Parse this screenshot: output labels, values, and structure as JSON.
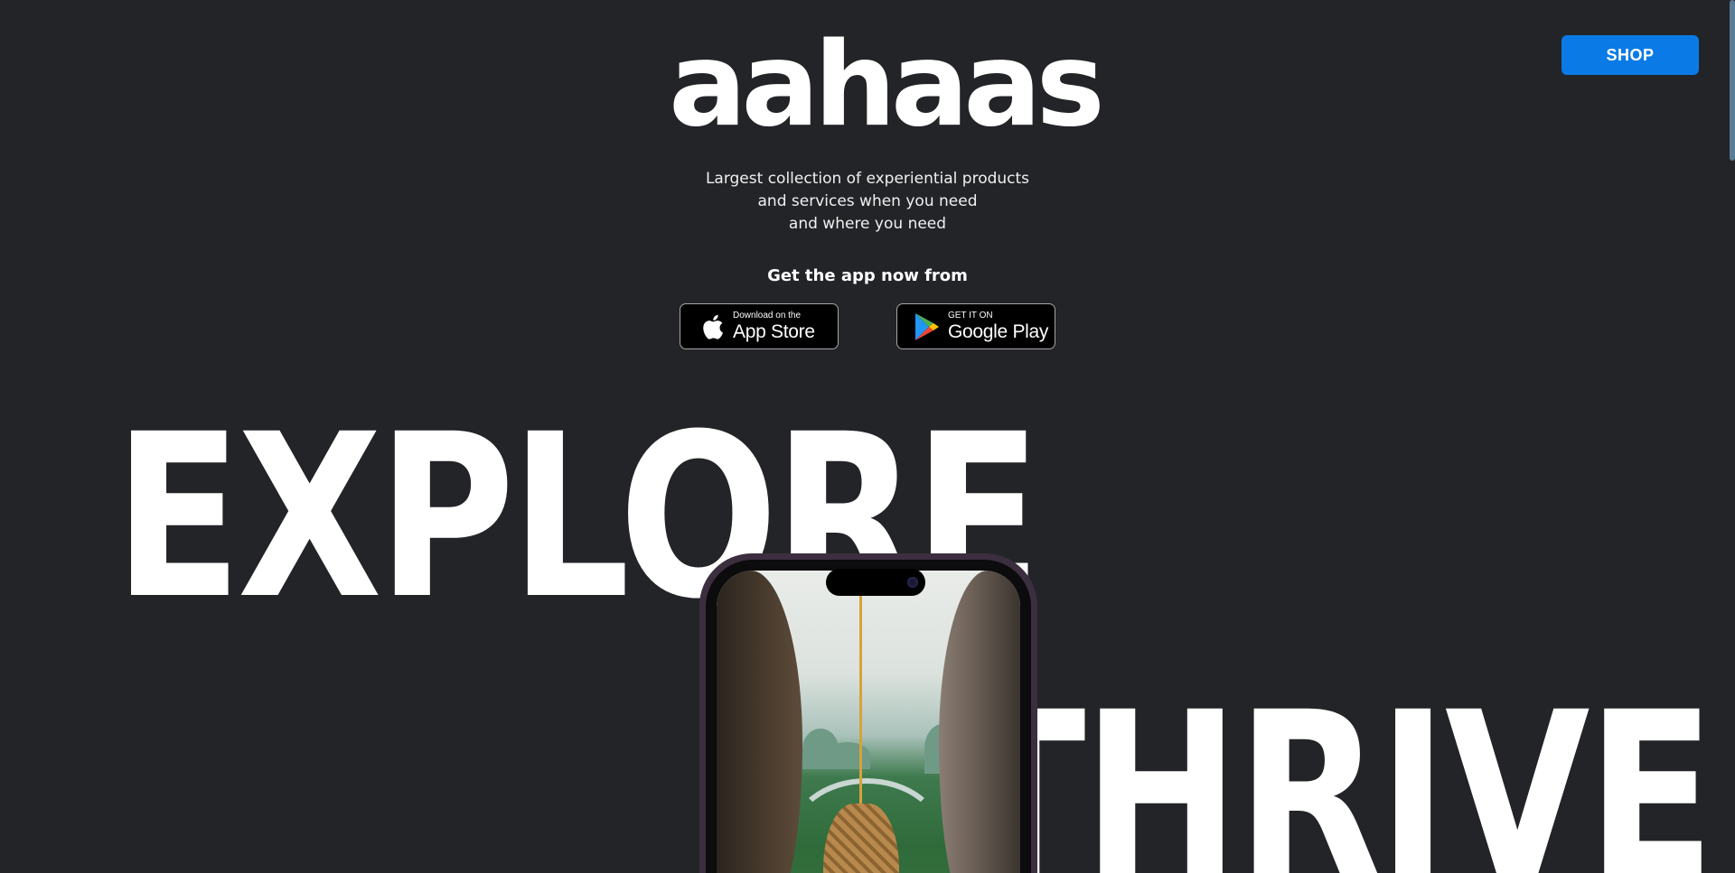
{
  "header": {
    "logo_text": "aahaas",
    "shop_label": "SHOP"
  },
  "hero": {
    "tagline_lines": [
      "Largest collection of experiential products",
      "and services when you need",
      "and where you need"
    ],
    "get_app_label": "Get the app now from",
    "app_store": {
      "small": "Download on the",
      "big": "App Store"
    },
    "google_play": {
      "small": "GET IT ON",
      "big": "Google Play"
    }
  },
  "banner": {
    "word_1": "EXPLORE",
    "word_2": "THRIVE"
  },
  "icons": {
    "apple": "apple-icon",
    "google_play": "google-play-icon"
  },
  "colors": {
    "background": "#232428",
    "accent": "#0a7be6"
  }
}
